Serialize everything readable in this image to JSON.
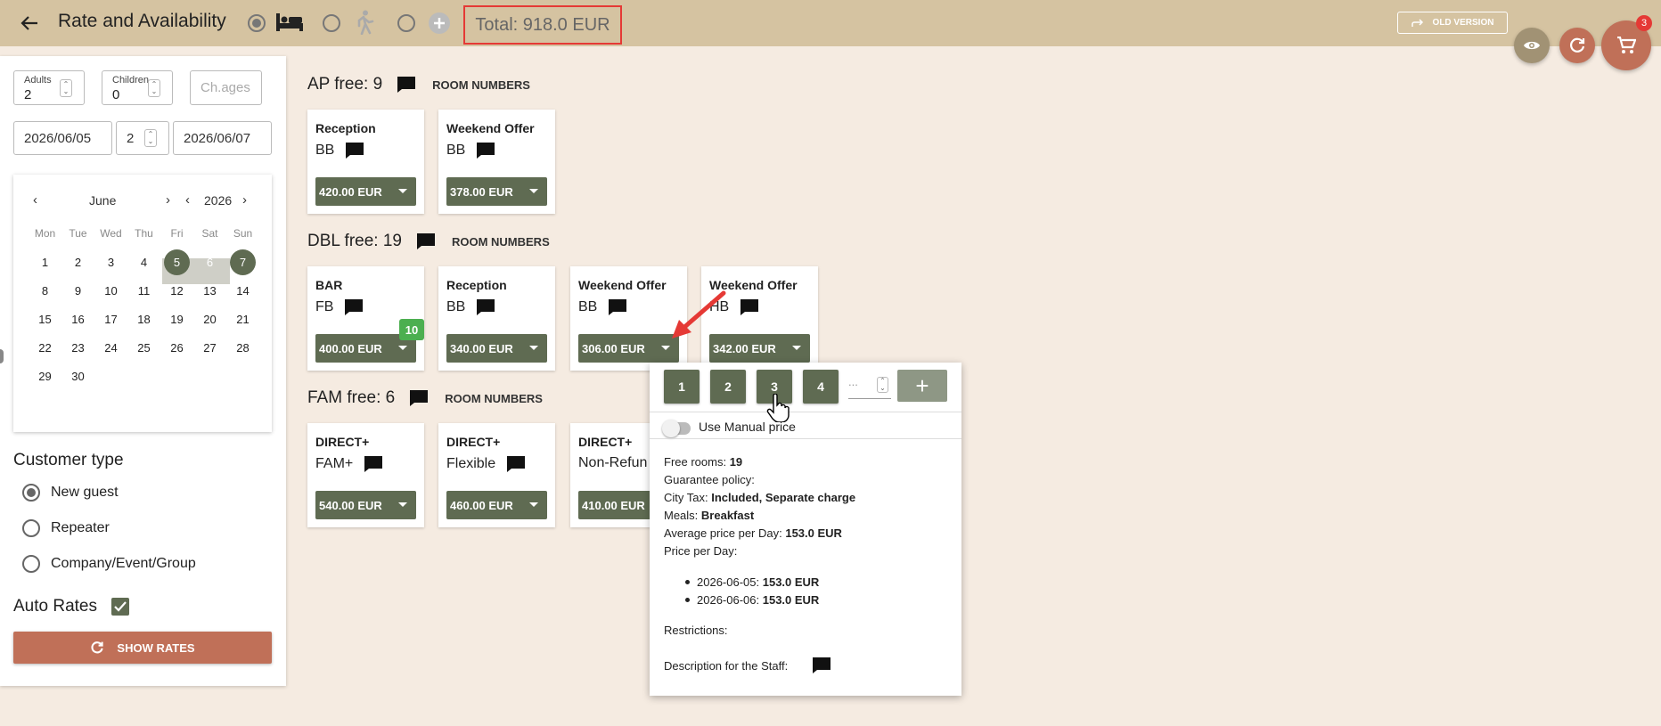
{
  "header": {
    "title": "Rate and Availability",
    "total": "Total: 918.0 EUR",
    "old_version": "OLD VERSION",
    "cart_count": "3"
  },
  "search": {
    "adults_label": "Adults",
    "adults": "2",
    "children_label": "Children",
    "children": "0",
    "child_ages_placeholder": "Ch.ages",
    "date_from": "2026/06/05",
    "nights": "2",
    "date_to": "2026/06/07"
  },
  "calendar": {
    "month": "June",
    "year": "2026",
    "weekdays": [
      "Mon",
      "Tue",
      "Wed",
      "Thu",
      "Fri",
      "Sat",
      "Sun"
    ],
    "days": [
      "1",
      "2",
      "3",
      "4",
      "5",
      "6",
      "7",
      "8",
      "9",
      "10",
      "11",
      "12",
      "13",
      "14",
      "15",
      "16",
      "17",
      "18",
      "19",
      "20",
      "21",
      "22",
      "23",
      "24",
      "25",
      "26",
      "27",
      "28",
      "29",
      "30"
    ]
  },
  "customer": {
    "title": "Customer type",
    "options": [
      "New guest",
      "Repeater",
      "Company/Event/Group"
    ]
  },
  "auto_rates": "Auto Rates",
  "show_rates": "SHOW RATES",
  "room_numbers": "ROOM NUMBERS",
  "rooms": [
    {
      "title": "AP free: 9",
      "cards": [
        {
          "name": "Reception",
          "meal": "BB",
          "price": "420.00 EUR"
        },
        {
          "name": "Weekend Offer",
          "meal": "BB",
          "price": "378.00 EUR"
        }
      ]
    },
    {
      "title": "DBL free: 19",
      "badge": "10",
      "cards": [
        {
          "name": "BAR",
          "meal": "FB",
          "price": "400.00 EUR"
        },
        {
          "name": "Reception",
          "meal": "BB",
          "price": "340.00 EUR"
        },
        {
          "name": "Weekend Offer",
          "meal": "BB",
          "price": "306.00 EUR"
        },
        {
          "name": "Weekend Offer",
          "meal": "HB",
          "price": "342.00 EUR"
        }
      ]
    },
    {
      "title": "FAM free: 6",
      "cards": [
        {
          "name": "DIRECT+",
          "meal": "FAM+",
          "price": "540.00 EUR"
        },
        {
          "name": "DIRECT+",
          "meal": "Flexible",
          "price": "460.00 EUR"
        },
        {
          "name": "DIRECT+",
          "meal": "Non-Refun",
          "price": "410.00 EUR"
        }
      ]
    }
  ],
  "popup": {
    "quantities": [
      "1",
      "2",
      "3",
      "4"
    ],
    "qty_placeholder": "...",
    "manual_price": "Use Manual price",
    "free_rooms_label": "Free rooms: ",
    "free_rooms": "19",
    "guarantee": "Guarantee policy:",
    "city_tax_label": "City Tax: ",
    "city_tax": "Included, Separate charge",
    "meals_label": "Meals: ",
    "meals": "Breakfast",
    "avg_label": "Average price per Day: ",
    "avg": "153.0 EUR",
    "per_day": "Price per Day:",
    "days": [
      {
        "date": "2026-06-05: ",
        "price": "153.0 EUR"
      },
      {
        "date": "2026-06-06: ",
        "price": "153.0 EUR"
      }
    ],
    "restrictions": "Restrictions:",
    "staff_desc": "Description for the Staff:"
  },
  "colors": {
    "accent_green": "#5f6b52",
    "topbar": "#d5c3a1",
    "show_rates": "#c07058",
    "badge_green": "#4caf50",
    "highlight_red": "#e53935"
  }
}
